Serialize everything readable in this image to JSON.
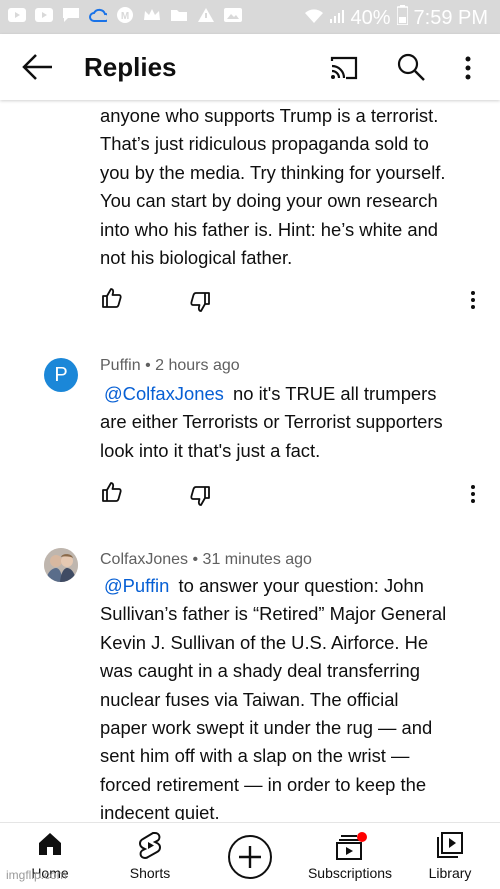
{
  "status_bar": {
    "battery": "40%",
    "time": "7:59 PM"
  },
  "header": {
    "title": "Replies"
  },
  "comments": [
    {
      "text_lines": [
        "anyone who supports Trump is a terrorist.",
        "That’s just ridiculous propaganda sold to",
        "you by the media. Try thinking for yourself.",
        "You can start by doing your own research",
        "into who his father is. Hint: he’s white and",
        "not his biological father."
      ]
    },
    {
      "avatar_letter": "P",
      "author": "Puffin",
      "time": "2 hours ago",
      "mention": "@ColfaxJones",
      "text_first": "no it's TRUE all trumpers",
      "text_lines": [
        "are either Terrorists or Terrorist supporters",
        "look into it that's just a fact."
      ]
    },
    {
      "author": "ColfaxJones",
      "time": "31 minutes ago",
      "mention": "@Puffin",
      "text_first": "to answer your question: John",
      "text_lines": [
        "Sullivan’s father is “Retired” Major General",
        "Kevin J. Sullivan of the U.S. Airforce. He",
        "was caught in a shady deal transferring",
        "nuclear fuses via Taiwan. The official",
        "paper work swept it under the rug — and",
        "sent him off with a slap on the wrist —",
        "forced retirement — in order to keep the",
        "indecent quiet."
      ]
    }
  ],
  "nav": {
    "home": "Home",
    "shorts": "Shorts",
    "subscriptions": "Subscriptions",
    "library": "Library"
  },
  "watermark": "imgflip.com",
  "colors": {
    "mention": "#065fd4",
    "avatar_p": "#1b87d8",
    "notification_dot": "#ff0000"
  }
}
